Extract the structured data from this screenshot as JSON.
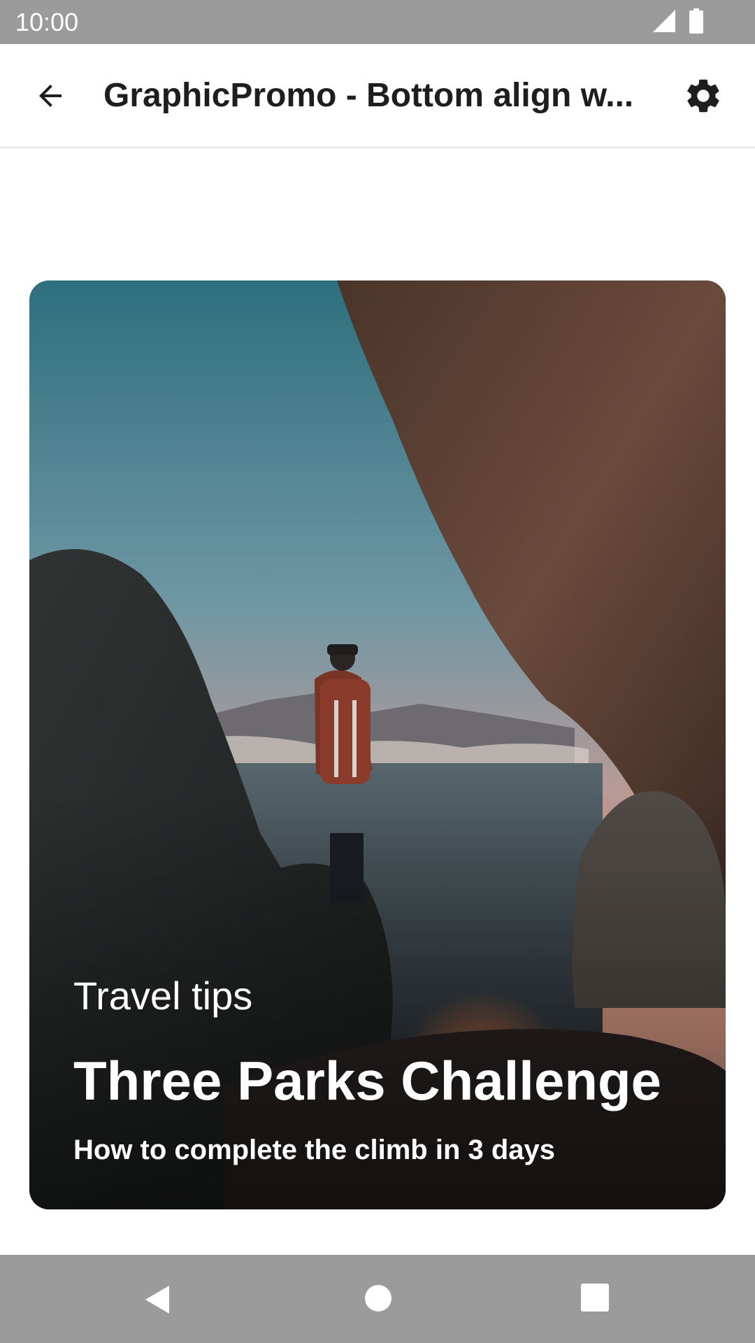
{
  "status_bar": {
    "time": "10:00",
    "icons": [
      "signal-icon",
      "battery-icon"
    ]
  },
  "app_bar": {
    "back_icon": "arrow-back-icon",
    "title": "GraphicPromo - Bottom align w...",
    "settings_icon": "gear-icon"
  },
  "promo": {
    "overline": "Travel tips",
    "title": "Three Parks Challenge",
    "subtitle": "How to complete the climb in 3 days"
  },
  "nav_bar": {
    "icons": [
      "nav-back-icon",
      "nav-home-icon",
      "nav-recents-icon"
    ]
  },
  "colors": {
    "system_bar": "#9b9b9b",
    "title_text": "#1e1e1e",
    "promo_text": "#ffffff"
  }
}
